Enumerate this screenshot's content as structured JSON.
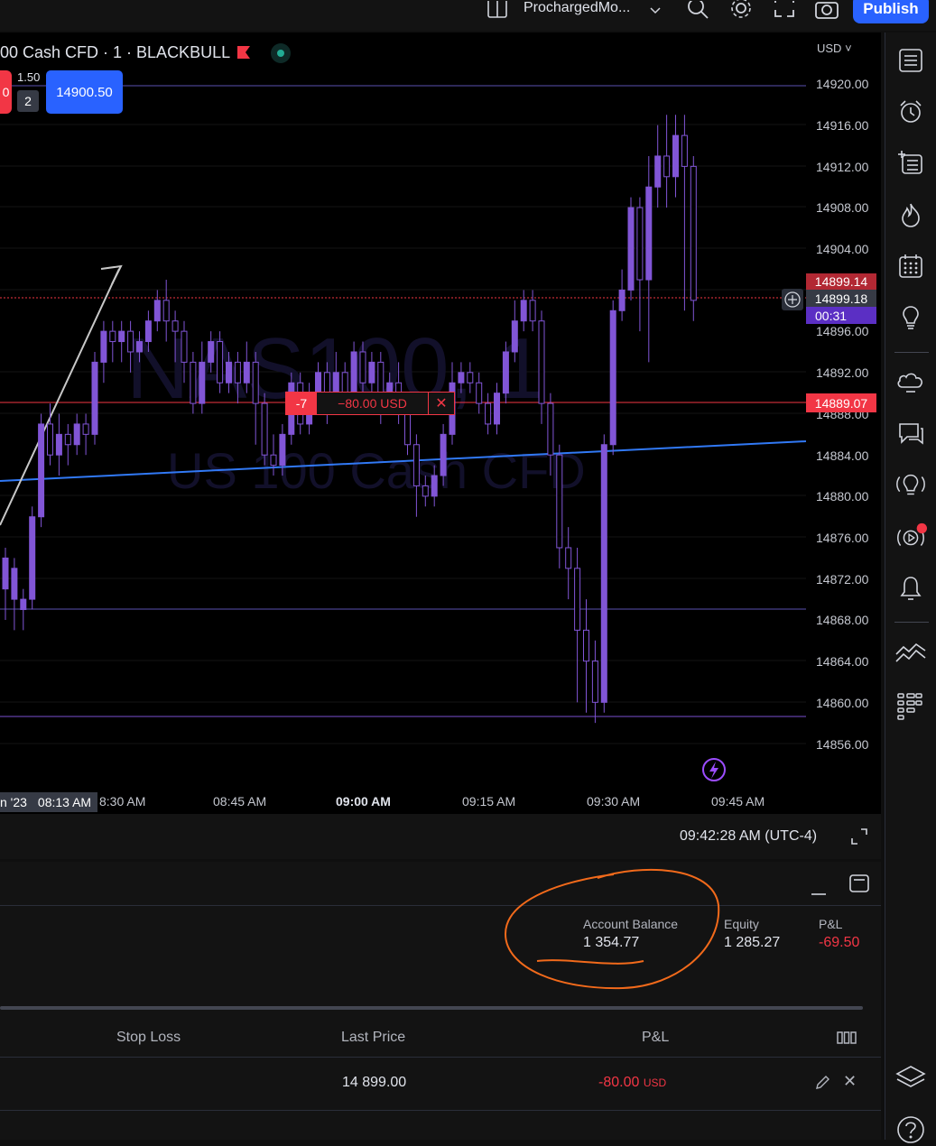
{
  "toolbar": {
    "layout_name": "ProchargedMo...",
    "publish_label": "Publish"
  },
  "chart": {
    "symbol_legend": "00 Cash CFD · 1 · BLACKBULL",
    "watermark_symbol": "NAS100, 1",
    "watermark_desc": "US 100 Cash CFD",
    "sell_price_partial": "0",
    "spread": "1.50",
    "quantity": "2",
    "buy_price": "14900.50",
    "currency": "USD",
    "price_ticks": [
      "14920.00",
      "14916.00",
      "14912.00",
      "14908.00",
      "14904.00",
      "14896.00",
      "14892.00",
      "14888.00",
      "14884.00",
      "14880.00",
      "14876.00",
      "14872.00",
      "14868.00",
      "14864.00",
      "14860.00",
      "14856.00"
    ],
    "time_ticks": [
      "8:30 AM",
      "08:45 AM",
      "09:00 AM",
      "09:15 AM",
      "09:30 AM",
      "09:45 AM"
    ],
    "date_label": "n '23",
    "crosshair_time": "08:13 AM",
    "price_labels": {
      "red_top": "14899.14",
      "current": "14899.18",
      "countdown": "00:31",
      "position_line": "14889.07"
    },
    "position": {
      "qty": "-7",
      "pnl": "−80.00 USD"
    },
    "colors": {
      "candle": "#8155d6",
      "trend_blue": "#3179f5",
      "red": "#f23645",
      "blue_btn": "#2962ff",
      "annotation": "#f26a1b"
    }
  },
  "time_bar": {
    "clock": "09:42:28 AM (UTC-4)"
  },
  "account": {
    "balance_label": "Account Balance",
    "balance_value": "1 354.77",
    "equity_label": "Equity",
    "equity_value": "1 285.27",
    "pnl_label": "P&L",
    "pnl_value": "-69.50"
  },
  "positions_table": {
    "headers": [
      "Stop Loss",
      "Last Price",
      "P&L"
    ],
    "row": {
      "last_price": "14 899.00",
      "pnl": "-80.00",
      "pnl_ccy": "USD"
    }
  }
}
